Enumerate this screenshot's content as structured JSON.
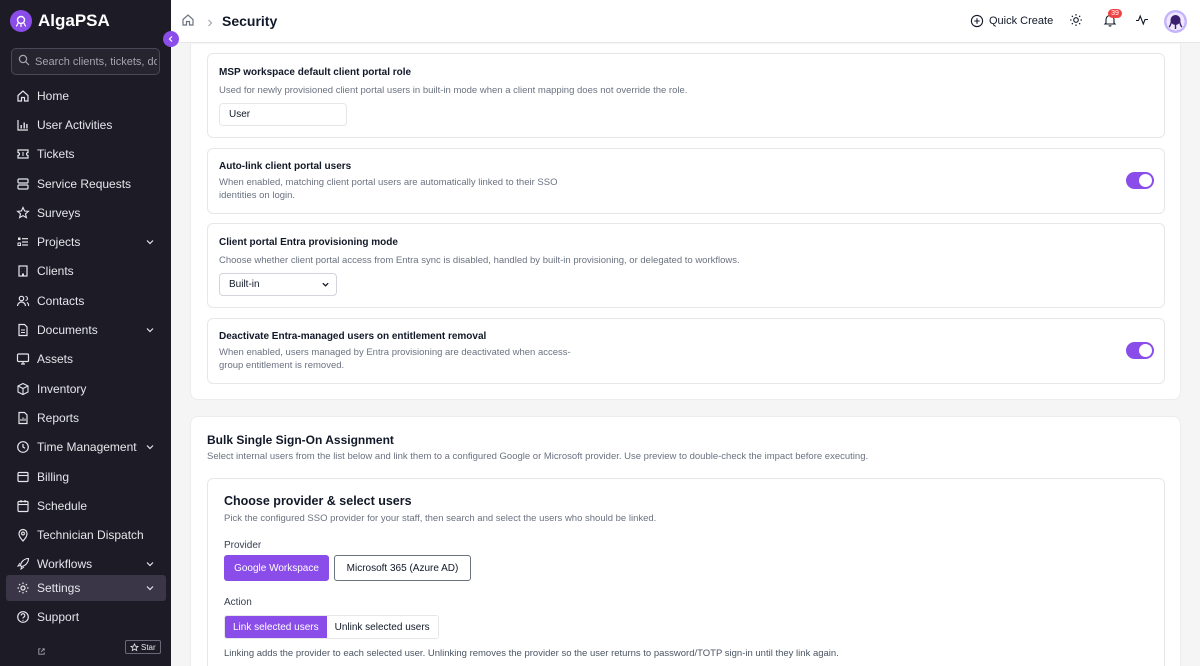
{
  "app": {
    "name": "AlgaPSA",
    "brand_color": "#8a4dea"
  },
  "search": {
    "placeholder": "Search clients, tickets, doc"
  },
  "sidebar": {
    "items": [
      {
        "label": "Home",
        "icon": "home-icon"
      },
      {
        "label": "User Activities",
        "icon": "bar-chart-icon"
      },
      {
        "label": "Tickets",
        "icon": "ticket-icon"
      },
      {
        "label": "Service Requests",
        "icon": "service-requests-icon"
      },
      {
        "label": "Surveys",
        "icon": "star-icon"
      },
      {
        "label": "Projects",
        "icon": "projects-icon",
        "expandable": true
      },
      {
        "label": "Clients",
        "icon": "building-icon"
      },
      {
        "label": "Contacts",
        "icon": "users-icon"
      },
      {
        "label": "Documents",
        "icon": "document-icon",
        "expandable": true
      },
      {
        "label": "Assets",
        "icon": "monitor-icon"
      },
      {
        "label": "Inventory",
        "icon": "box-icon"
      },
      {
        "label": "Reports",
        "icon": "report-icon"
      },
      {
        "label": "Time Management",
        "icon": "clock-icon",
        "expandable": true
      },
      {
        "label": "Billing",
        "icon": "receipt-icon"
      },
      {
        "label": "Schedule",
        "icon": "calendar-icon"
      },
      {
        "label": "Technician Dispatch",
        "icon": "map-pin-icon"
      },
      {
        "label": "Workflows",
        "icon": "rocket-icon",
        "expandable": true
      },
      {
        "label": "Settings",
        "icon": "gear-icon",
        "expandable": true,
        "active": true
      },
      {
        "label": "Support",
        "icon": "help-icon"
      }
    ],
    "star_label": "Star"
  },
  "header": {
    "title": "Security",
    "quick_create": "Quick Create",
    "notification_count": "39"
  },
  "settings": {
    "default_role": {
      "title": "MSP workspace default client portal role",
      "description": "Used for newly provisioned client portal users in built-in mode when a client mapping does not override the role.",
      "value": "User"
    },
    "auto_link": {
      "title": "Auto-link client portal users",
      "description_1": "When enabled, matching client portal users are automatically linked to their SSO",
      "description_2": "identities on login.",
      "enabled": true
    },
    "provisioning_mode": {
      "title": "Client portal Entra provisioning mode",
      "description": "Choose whether client portal access from Entra sync is disabled, handled by built-in provisioning, or delegated to workflows.",
      "selected": "Built-in"
    },
    "deactivate": {
      "title": "Deactivate Entra-managed users on entitlement removal",
      "description_1": "When enabled, users managed by Entra provisioning are deactivated when access-",
      "description_2": "group entitlement is removed.",
      "enabled": true
    }
  },
  "bulk_sso": {
    "title": "Bulk Single Sign-On Assignment",
    "description": "Select internal users from the list below and link them to a configured Google or Microsoft provider. Use preview to double-check the impact before executing.",
    "card_title": "Choose provider & select users",
    "card_description": "Pick the configured SSO provider for your staff, then search and select the users who should be linked.",
    "provider_label": "Provider",
    "providers": [
      "Google Workspace",
      "Microsoft 365 (Azure AD)"
    ],
    "selected_provider": "Google Workspace",
    "action_label": "Action",
    "actions": [
      "Link selected users",
      "Unlink selected users"
    ],
    "selected_action": "Link selected users",
    "note": "Linking adds the provider to each selected user. Unlinking removes the provider so the user returns to password/TOTP sign-in until they link again."
  }
}
